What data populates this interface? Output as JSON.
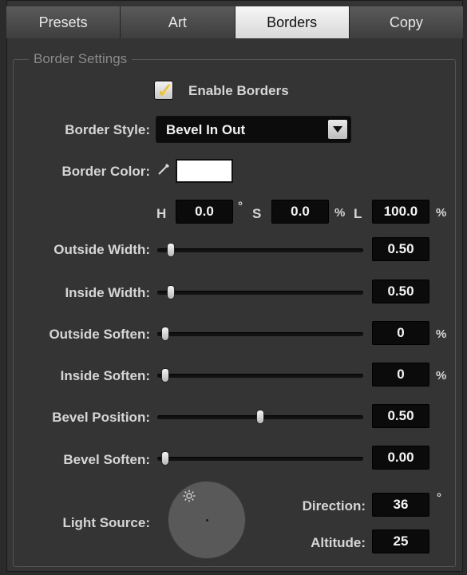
{
  "tabs": [
    "Presets",
    "Art",
    "Borders",
    "Copy"
  ],
  "active_tab": "Borders",
  "group_title": "Border Settings",
  "enable_borders": {
    "label": "Enable Borders",
    "checked": true,
    "check_mark": "✓"
  },
  "border_style": {
    "label": "Border Style:",
    "value": "Bevel In Out"
  },
  "border_color": {
    "label": "Border Color:",
    "swatch": "#ffffff"
  },
  "hsl": {
    "h_label": "H",
    "h_value": "0.0",
    "h_unit": "°",
    "s_label": "S",
    "s_value": "0.0",
    "s_unit": "%",
    "l_label": "L",
    "l_value": "100.0",
    "l_unit": "%"
  },
  "sliders": {
    "outside_width": {
      "label": "Outside Width:",
      "value": "0.50",
      "unit": "",
      "fraction": 0.05
    },
    "inside_width": {
      "label": "Inside Width:",
      "value": "0.50",
      "unit": "",
      "fraction": 0.05
    },
    "outside_soften": {
      "label": "Outside Soften:",
      "value": "0",
      "unit": "%",
      "fraction": 0.02
    },
    "inside_soften": {
      "label": "Inside Soften:",
      "value": "0",
      "unit": "%",
      "fraction": 0.02
    },
    "bevel_position": {
      "label": "Bevel Position:",
      "value": "0.50",
      "unit": "",
      "fraction": 0.5
    },
    "bevel_soften": {
      "label": "Bevel Soften:",
      "value": "0.00",
      "unit": "",
      "fraction": 0.02
    }
  },
  "light_source": {
    "label": "Light Source:",
    "direction_label": "Direction:",
    "direction_value": "36",
    "direction_unit": "°",
    "altitude_label": "Altitude:",
    "altitude_value": "25"
  },
  "colors": {
    "accent_check": "#f3c10f",
    "panel_bg": "#343434",
    "field_bg": "#0b0b0b"
  }
}
